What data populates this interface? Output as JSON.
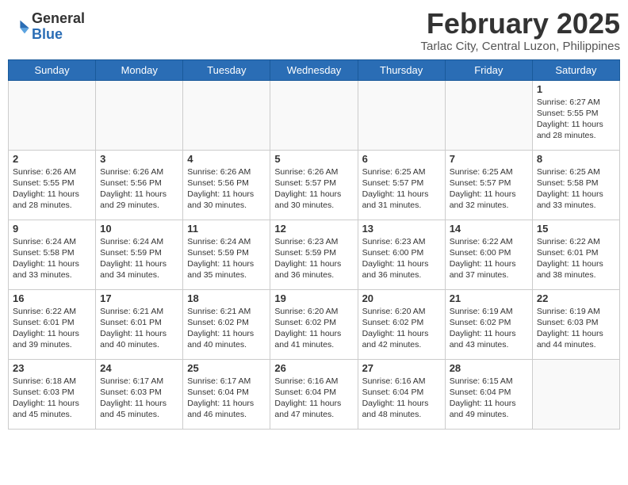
{
  "header": {
    "logo_general": "General",
    "logo_blue": "Blue",
    "month_title": "February 2025",
    "location": "Tarlac City, Central Luzon, Philippines"
  },
  "days_of_week": [
    "Sunday",
    "Monday",
    "Tuesday",
    "Wednesday",
    "Thursday",
    "Friday",
    "Saturday"
  ],
  "weeks": [
    [
      {
        "day": "",
        "info": ""
      },
      {
        "day": "",
        "info": ""
      },
      {
        "day": "",
        "info": ""
      },
      {
        "day": "",
        "info": ""
      },
      {
        "day": "",
        "info": ""
      },
      {
        "day": "",
        "info": ""
      },
      {
        "day": "1",
        "info": "Sunrise: 6:27 AM\nSunset: 5:55 PM\nDaylight: 11 hours and 28 minutes."
      }
    ],
    [
      {
        "day": "2",
        "info": "Sunrise: 6:26 AM\nSunset: 5:55 PM\nDaylight: 11 hours and 28 minutes."
      },
      {
        "day": "3",
        "info": "Sunrise: 6:26 AM\nSunset: 5:56 PM\nDaylight: 11 hours and 29 minutes."
      },
      {
        "day": "4",
        "info": "Sunrise: 6:26 AM\nSunset: 5:56 PM\nDaylight: 11 hours and 30 minutes."
      },
      {
        "day": "5",
        "info": "Sunrise: 6:26 AM\nSunset: 5:57 PM\nDaylight: 11 hours and 30 minutes."
      },
      {
        "day": "6",
        "info": "Sunrise: 6:25 AM\nSunset: 5:57 PM\nDaylight: 11 hours and 31 minutes."
      },
      {
        "day": "7",
        "info": "Sunrise: 6:25 AM\nSunset: 5:57 PM\nDaylight: 11 hours and 32 minutes."
      },
      {
        "day": "8",
        "info": "Sunrise: 6:25 AM\nSunset: 5:58 PM\nDaylight: 11 hours and 33 minutes."
      }
    ],
    [
      {
        "day": "9",
        "info": "Sunrise: 6:24 AM\nSunset: 5:58 PM\nDaylight: 11 hours and 33 minutes."
      },
      {
        "day": "10",
        "info": "Sunrise: 6:24 AM\nSunset: 5:59 PM\nDaylight: 11 hours and 34 minutes."
      },
      {
        "day": "11",
        "info": "Sunrise: 6:24 AM\nSunset: 5:59 PM\nDaylight: 11 hours and 35 minutes."
      },
      {
        "day": "12",
        "info": "Sunrise: 6:23 AM\nSunset: 5:59 PM\nDaylight: 11 hours and 36 minutes."
      },
      {
        "day": "13",
        "info": "Sunrise: 6:23 AM\nSunset: 6:00 PM\nDaylight: 11 hours and 36 minutes."
      },
      {
        "day": "14",
        "info": "Sunrise: 6:22 AM\nSunset: 6:00 PM\nDaylight: 11 hours and 37 minutes."
      },
      {
        "day": "15",
        "info": "Sunrise: 6:22 AM\nSunset: 6:01 PM\nDaylight: 11 hours and 38 minutes."
      }
    ],
    [
      {
        "day": "16",
        "info": "Sunrise: 6:22 AM\nSunset: 6:01 PM\nDaylight: 11 hours and 39 minutes."
      },
      {
        "day": "17",
        "info": "Sunrise: 6:21 AM\nSunset: 6:01 PM\nDaylight: 11 hours and 40 minutes."
      },
      {
        "day": "18",
        "info": "Sunrise: 6:21 AM\nSunset: 6:02 PM\nDaylight: 11 hours and 40 minutes."
      },
      {
        "day": "19",
        "info": "Sunrise: 6:20 AM\nSunset: 6:02 PM\nDaylight: 11 hours and 41 minutes."
      },
      {
        "day": "20",
        "info": "Sunrise: 6:20 AM\nSunset: 6:02 PM\nDaylight: 11 hours and 42 minutes."
      },
      {
        "day": "21",
        "info": "Sunrise: 6:19 AM\nSunset: 6:02 PM\nDaylight: 11 hours and 43 minutes."
      },
      {
        "day": "22",
        "info": "Sunrise: 6:19 AM\nSunset: 6:03 PM\nDaylight: 11 hours and 44 minutes."
      }
    ],
    [
      {
        "day": "23",
        "info": "Sunrise: 6:18 AM\nSunset: 6:03 PM\nDaylight: 11 hours and 45 minutes."
      },
      {
        "day": "24",
        "info": "Sunrise: 6:17 AM\nSunset: 6:03 PM\nDaylight: 11 hours and 45 minutes."
      },
      {
        "day": "25",
        "info": "Sunrise: 6:17 AM\nSunset: 6:04 PM\nDaylight: 11 hours and 46 minutes."
      },
      {
        "day": "26",
        "info": "Sunrise: 6:16 AM\nSunset: 6:04 PM\nDaylight: 11 hours and 47 minutes."
      },
      {
        "day": "27",
        "info": "Sunrise: 6:16 AM\nSunset: 6:04 PM\nDaylight: 11 hours and 48 minutes."
      },
      {
        "day": "28",
        "info": "Sunrise: 6:15 AM\nSunset: 6:04 PM\nDaylight: 11 hours and 49 minutes."
      },
      {
        "day": "",
        "info": ""
      }
    ]
  ]
}
